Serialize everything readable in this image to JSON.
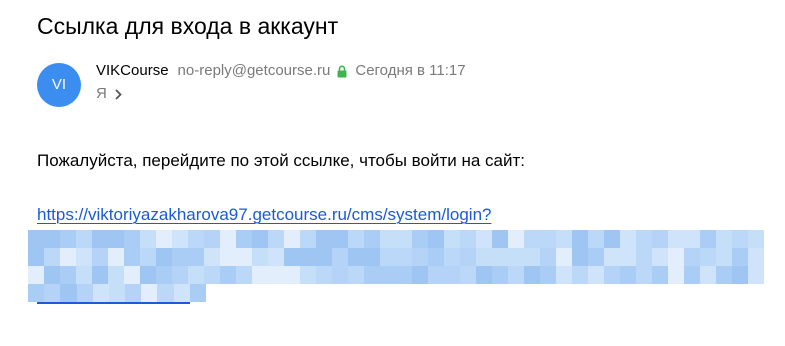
{
  "mail": {
    "subject": "Ссылка для входа в аккаунт",
    "sender": {
      "avatar_initials": "VI",
      "avatar_color": "#3b8df0",
      "name": "VIKCourse",
      "email": "no-reply@getcourse.ru",
      "secure_icon": "lock-icon",
      "secure_color": "#3fb34f"
    },
    "date": "Сегодня в 11:17",
    "recipient": "Я",
    "body": {
      "text": "Пожалуйста, перейдите по этой ссылке, чтобы войти на сайт:",
      "link": "https://viktoriyazakharova97.getcourse.ru/cms/system/login?",
      "link_color": "#1a5bd9",
      "link_remainder_redacted": true
    }
  }
}
